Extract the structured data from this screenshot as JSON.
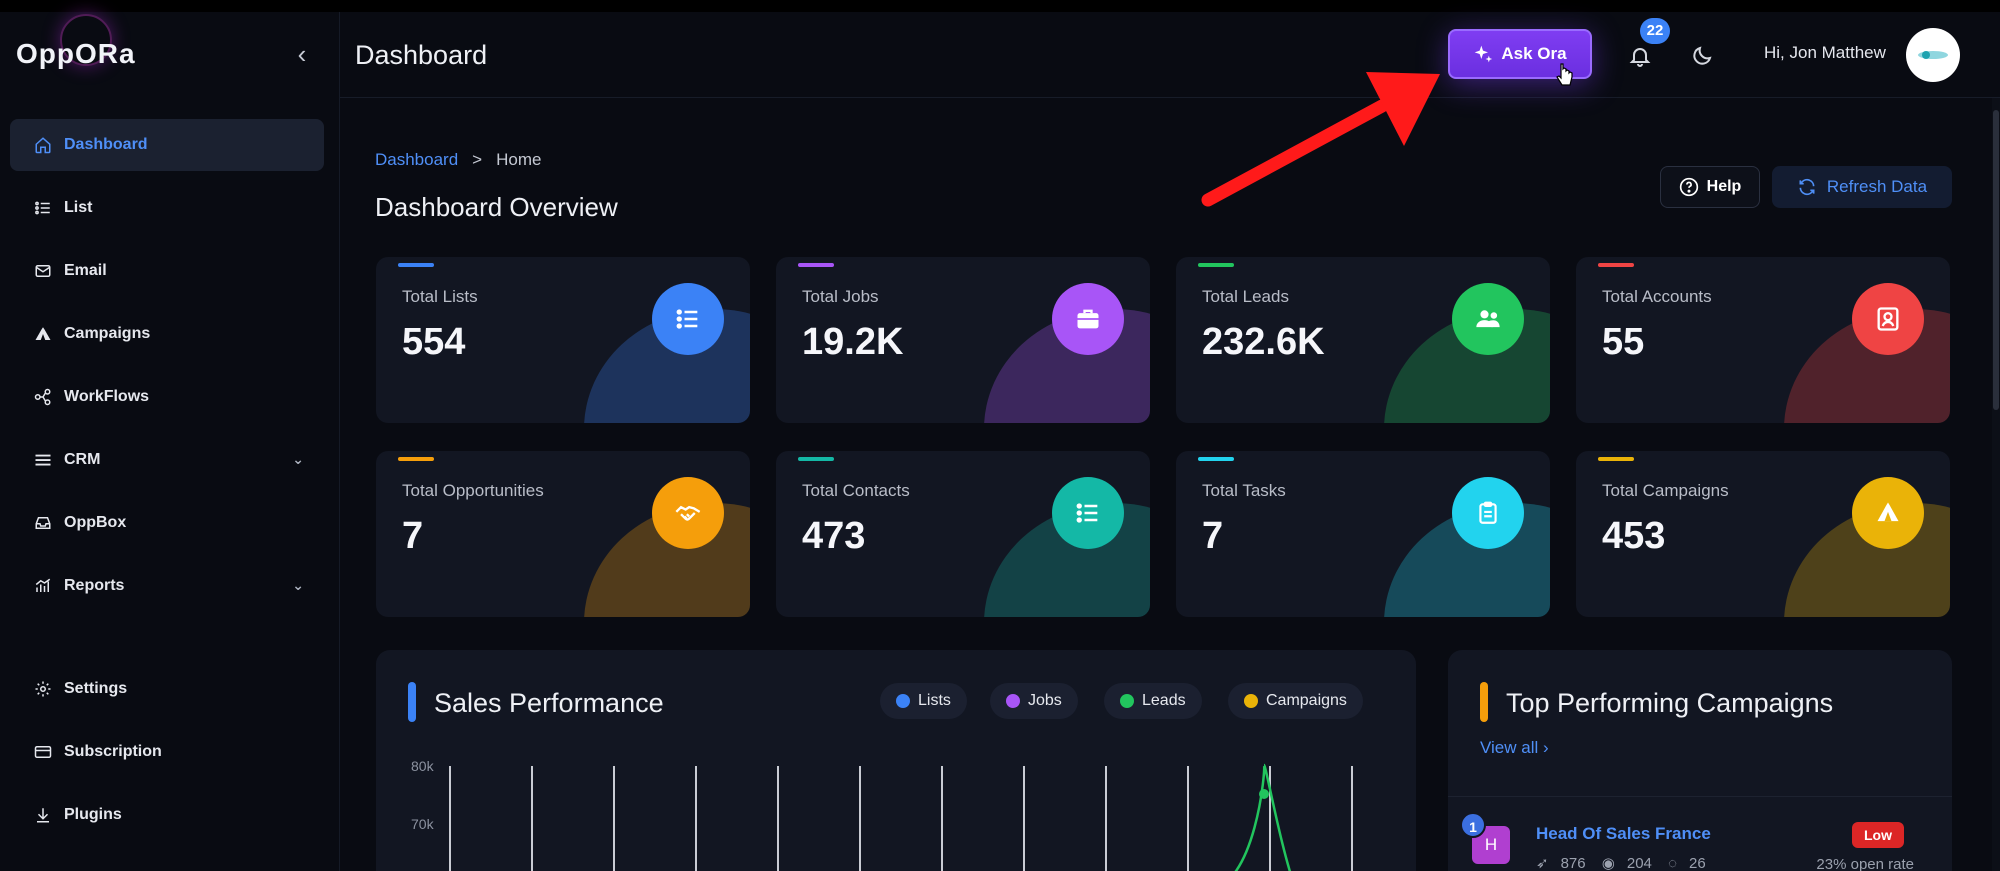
{
  "app": {
    "logo_text": "OppORa"
  },
  "sidebar": {
    "items": [
      {
        "label": "Dashboard",
        "icon": "home-icon",
        "active": true
      },
      {
        "label": "List",
        "icon": "list-icon"
      },
      {
        "label": "Email",
        "icon": "mail-icon"
      },
      {
        "label": "Campaigns",
        "icon": "tent-icon"
      },
      {
        "label": "WorkFlows",
        "icon": "workflow-icon"
      },
      {
        "label": "CRM",
        "icon": "menu-icon",
        "expandable": true
      },
      {
        "label": "OppBox",
        "icon": "inbox-icon"
      },
      {
        "label": "Reports",
        "icon": "chart-icon",
        "expandable": true
      }
    ],
    "bottom_items": [
      {
        "label": "Settings",
        "icon": "gear-icon"
      },
      {
        "label": "Subscription",
        "icon": "card-icon"
      },
      {
        "label": "Plugins",
        "icon": "download-icon"
      }
    ]
  },
  "header": {
    "title": "Dashboard",
    "ask_button": "Ask Ora",
    "notification_count": "22",
    "greeting": "Hi, Jon Matthew"
  },
  "main": {
    "breadcrumb": {
      "root": "Dashboard",
      "separator": ">",
      "current": "Home"
    },
    "title": "Dashboard Overview",
    "help_button": "Help",
    "refresh_button": "Refresh Data"
  },
  "stats": [
    {
      "label": "Total Lists",
      "value": "554",
      "color": "#3b82f6"
    },
    {
      "label": "Total Jobs",
      "value": "19.2K",
      "color": "#a855f7"
    },
    {
      "label": "Total Leads",
      "value": "232.6K",
      "color": "#22c55e"
    },
    {
      "label": "Total Accounts",
      "value": "55",
      "color": "#ef4444"
    },
    {
      "label": "Total Opportunities",
      "value": "7",
      "color": "#f59e0b"
    },
    {
      "label": "Total Contacts",
      "value": "473",
      "color": "#14b8a6"
    },
    {
      "label": "Total Tasks",
      "value": "7",
      "color": "#22d3ee"
    },
    {
      "label": "Total Campaigns",
      "value": "453",
      "color": "#eab308"
    }
  ],
  "sales_performance": {
    "title": "Sales Performance",
    "legend": [
      {
        "label": "Lists",
        "color": "#3b82f6"
      },
      {
        "label": "Jobs",
        "color": "#a855f7"
      },
      {
        "label": "Leads",
        "color": "#22c55e"
      },
      {
        "label": "Campaigns",
        "color": "#eab308"
      }
    ],
    "y_ticks": [
      "80k",
      "70k"
    ]
  },
  "chart_data": {
    "type": "line",
    "title": "Sales Performance",
    "series": [
      {
        "name": "Lists",
        "values": []
      },
      {
        "name": "Jobs",
        "values": []
      },
      {
        "name": "Leads",
        "values": []
      },
      {
        "name": "Campaigns",
        "values": []
      }
    ],
    "y_ticks": [
      "80k",
      "70k"
    ],
    "legend_position": "top-right",
    "grid": true
  },
  "top_campaigns": {
    "title": "Top Performing Campaigns",
    "view_all": "View all",
    "items": [
      {
        "rank": "1",
        "avatar_letter": "H",
        "name": "Head Of Sales France",
        "sent": "876",
        "views": "204",
        "replies": "26",
        "badge": "Low",
        "open_rate": "23% open rate"
      }
    ]
  }
}
